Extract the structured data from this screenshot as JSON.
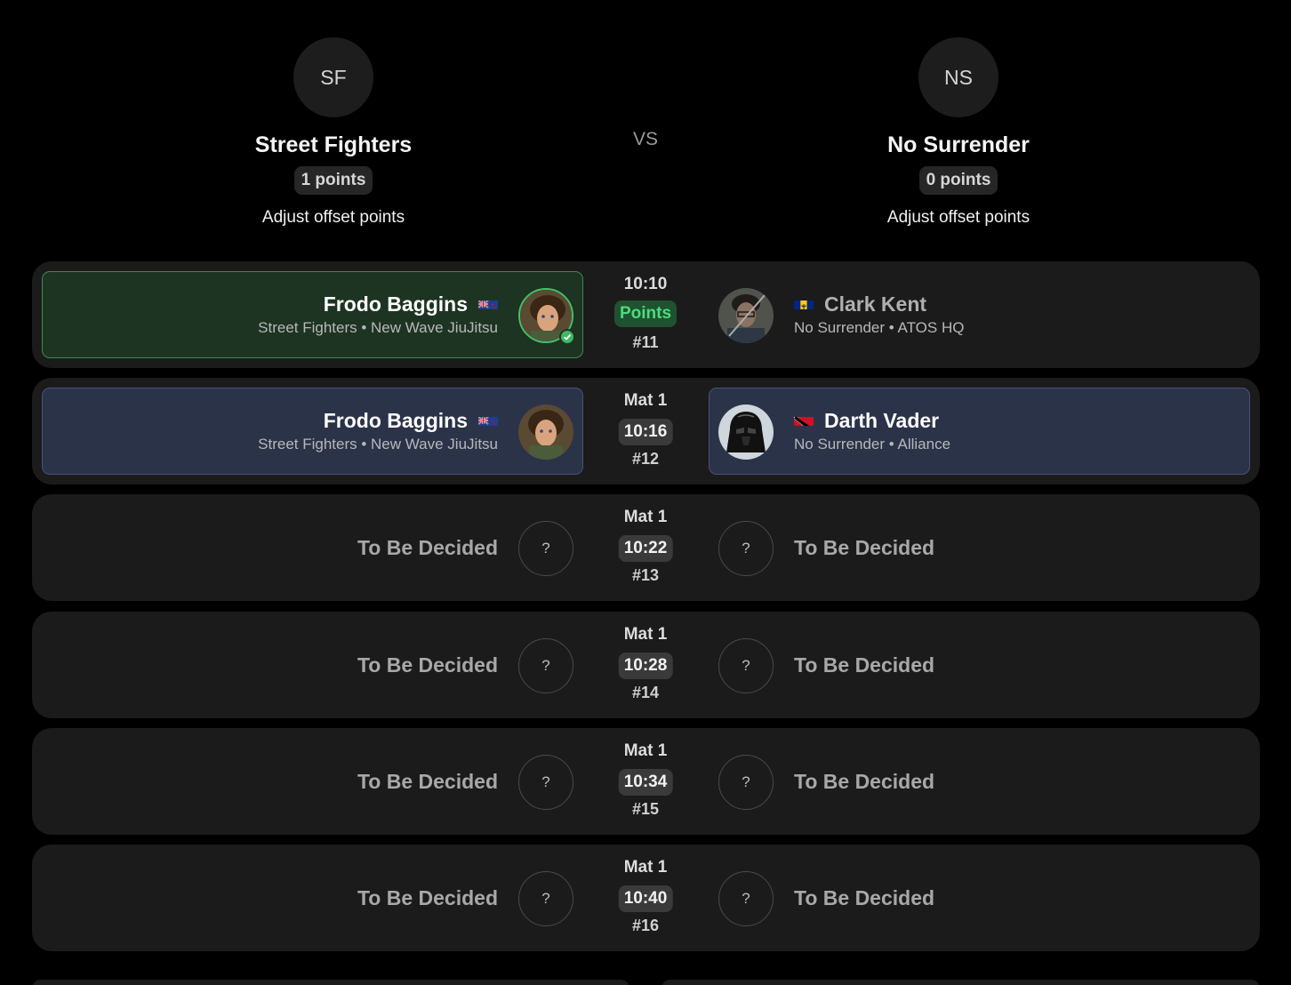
{
  "team_left": {
    "initials": "SF",
    "name": "Street Fighters",
    "points": "1 points",
    "adjust": "Adjust offset points"
  },
  "team_right": {
    "initials": "NS",
    "name": "No Surrender",
    "points": "0 points",
    "adjust": "Adjust offset points"
  },
  "vs": "VS",
  "matches": [
    {
      "time": "10:10",
      "result": "Points",
      "number": "#11",
      "left": {
        "name": "Frodo Baggins",
        "sub": "Street Fighters • New Wave JiuJitsu",
        "flag": "new-zealand",
        "avatar": "frodo-avatar",
        "winner": true
      },
      "right": {
        "name": "Clark Kent",
        "sub": "No Surrender • ATOS HQ",
        "flag": "barbados",
        "avatar": "clark-avatar",
        "loser": true
      }
    },
    {
      "mat": "Mat 1",
      "time": "10:16",
      "number": "#12",
      "left": {
        "name": "Frodo Baggins",
        "sub": "Street Fighters • New Wave JiuJitsu",
        "flag": "new-zealand",
        "avatar": "frodo-avatar"
      },
      "right": {
        "name": "Darth Vader",
        "sub": "No Surrender • Alliance",
        "flag": "trinidad-and-tobago",
        "avatar": "vader-avatar"
      }
    },
    {
      "mat": "Mat 1",
      "time": "10:22",
      "number": "#13",
      "left": {
        "name": "To Be Decided",
        "avatar": "?"
      },
      "right": {
        "name": "To Be Decided",
        "avatar": "?"
      }
    },
    {
      "mat": "Mat 1",
      "time": "10:28",
      "number": "#14",
      "left": {
        "name": "To Be Decided",
        "avatar": "?"
      },
      "right": {
        "name": "To Be Decided",
        "avatar": "?"
      }
    },
    {
      "mat": "Mat 1",
      "time": "10:34",
      "number": "#15",
      "left": {
        "name": "To Be Decided",
        "avatar": "?"
      },
      "right": {
        "name": "To Be Decided",
        "avatar": "?"
      }
    },
    {
      "mat": "Mat 1",
      "time": "10:40",
      "number": "#16",
      "left": {
        "name": "To Be Decided",
        "avatar": "?"
      },
      "right": {
        "name": "To Be Decided",
        "avatar": "?"
      }
    }
  ],
  "colors": {
    "win_bg": "#1d3422",
    "win_border": "#3d8a53",
    "active_bg": "#2b3349",
    "row_bg": "#1b1b1b",
    "points_green": "#4ddb7c"
  }
}
